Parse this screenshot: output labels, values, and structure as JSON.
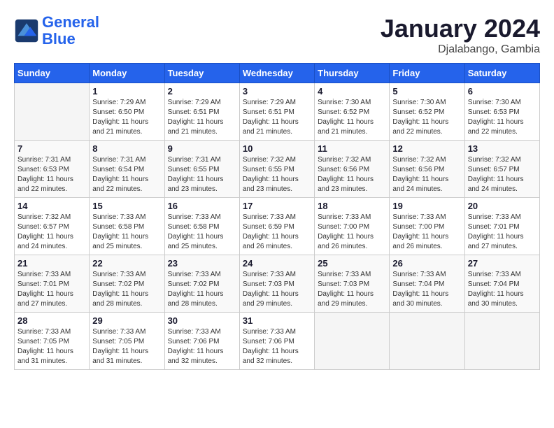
{
  "logo": {
    "line1": "General",
    "line2": "Blue"
  },
  "title": "January 2024",
  "subtitle": "Djalabango, Gambia",
  "days_header": [
    "Sunday",
    "Monday",
    "Tuesday",
    "Wednesday",
    "Thursday",
    "Friday",
    "Saturday"
  ],
  "weeks": [
    [
      {
        "num": "",
        "info": ""
      },
      {
        "num": "1",
        "info": "Sunrise: 7:29 AM\nSunset: 6:50 PM\nDaylight: 11 hours and 21 minutes."
      },
      {
        "num": "2",
        "info": "Sunrise: 7:29 AM\nSunset: 6:51 PM\nDaylight: 11 hours and 21 minutes."
      },
      {
        "num": "3",
        "info": "Sunrise: 7:29 AM\nSunset: 6:51 PM\nDaylight: 11 hours and 21 minutes."
      },
      {
        "num": "4",
        "info": "Sunrise: 7:30 AM\nSunset: 6:52 PM\nDaylight: 11 hours and 21 minutes."
      },
      {
        "num": "5",
        "info": "Sunrise: 7:30 AM\nSunset: 6:52 PM\nDaylight: 11 hours and 22 minutes."
      },
      {
        "num": "6",
        "info": "Sunrise: 7:30 AM\nSunset: 6:53 PM\nDaylight: 11 hours and 22 minutes."
      }
    ],
    [
      {
        "num": "7",
        "info": "Sunrise: 7:31 AM\nSunset: 6:53 PM\nDaylight: 11 hours and 22 minutes."
      },
      {
        "num": "8",
        "info": "Sunrise: 7:31 AM\nSunset: 6:54 PM\nDaylight: 11 hours and 22 minutes."
      },
      {
        "num": "9",
        "info": "Sunrise: 7:31 AM\nSunset: 6:55 PM\nDaylight: 11 hours and 23 minutes."
      },
      {
        "num": "10",
        "info": "Sunrise: 7:32 AM\nSunset: 6:55 PM\nDaylight: 11 hours and 23 minutes."
      },
      {
        "num": "11",
        "info": "Sunrise: 7:32 AM\nSunset: 6:56 PM\nDaylight: 11 hours and 23 minutes."
      },
      {
        "num": "12",
        "info": "Sunrise: 7:32 AM\nSunset: 6:56 PM\nDaylight: 11 hours and 24 minutes."
      },
      {
        "num": "13",
        "info": "Sunrise: 7:32 AM\nSunset: 6:57 PM\nDaylight: 11 hours and 24 minutes."
      }
    ],
    [
      {
        "num": "14",
        "info": "Sunrise: 7:32 AM\nSunset: 6:57 PM\nDaylight: 11 hours and 24 minutes."
      },
      {
        "num": "15",
        "info": "Sunrise: 7:33 AM\nSunset: 6:58 PM\nDaylight: 11 hours and 25 minutes."
      },
      {
        "num": "16",
        "info": "Sunrise: 7:33 AM\nSunset: 6:58 PM\nDaylight: 11 hours and 25 minutes."
      },
      {
        "num": "17",
        "info": "Sunrise: 7:33 AM\nSunset: 6:59 PM\nDaylight: 11 hours and 26 minutes."
      },
      {
        "num": "18",
        "info": "Sunrise: 7:33 AM\nSunset: 7:00 PM\nDaylight: 11 hours and 26 minutes."
      },
      {
        "num": "19",
        "info": "Sunrise: 7:33 AM\nSunset: 7:00 PM\nDaylight: 11 hours and 26 minutes."
      },
      {
        "num": "20",
        "info": "Sunrise: 7:33 AM\nSunset: 7:01 PM\nDaylight: 11 hours and 27 minutes."
      }
    ],
    [
      {
        "num": "21",
        "info": "Sunrise: 7:33 AM\nSunset: 7:01 PM\nDaylight: 11 hours and 27 minutes."
      },
      {
        "num": "22",
        "info": "Sunrise: 7:33 AM\nSunset: 7:02 PM\nDaylight: 11 hours and 28 minutes."
      },
      {
        "num": "23",
        "info": "Sunrise: 7:33 AM\nSunset: 7:02 PM\nDaylight: 11 hours and 28 minutes."
      },
      {
        "num": "24",
        "info": "Sunrise: 7:33 AM\nSunset: 7:03 PM\nDaylight: 11 hours and 29 minutes."
      },
      {
        "num": "25",
        "info": "Sunrise: 7:33 AM\nSunset: 7:03 PM\nDaylight: 11 hours and 29 minutes."
      },
      {
        "num": "26",
        "info": "Sunrise: 7:33 AM\nSunset: 7:04 PM\nDaylight: 11 hours and 30 minutes."
      },
      {
        "num": "27",
        "info": "Sunrise: 7:33 AM\nSunset: 7:04 PM\nDaylight: 11 hours and 30 minutes."
      }
    ],
    [
      {
        "num": "28",
        "info": "Sunrise: 7:33 AM\nSunset: 7:05 PM\nDaylight: 11 hours and 31 minutes."
      },
      {
        "num": "29",
        "info": "Sunrise: 7:33 AM\nSunset: 7:05 PM\nDaylight: 11 hours and 31 minutes."
      },
      {
        "num": "30",
        "info": "Sunrise: 7:33 AM\nSunset: 7:06 PM\nDaylight: 11 hours and 32 minutes."
      },
      {
        "num": "31",
        "info": "Sunrise: 7:33 AM\nSunset: 7:06 PM\nDaylight: 11 hours and 32 minutes."
      },
      {
        "num": "",
        "info": ""
      },
      {
        "num": "",
        "info": ""
      },
      {
        "num": "",
        "info": ""
      }
    ]
  ]
}
